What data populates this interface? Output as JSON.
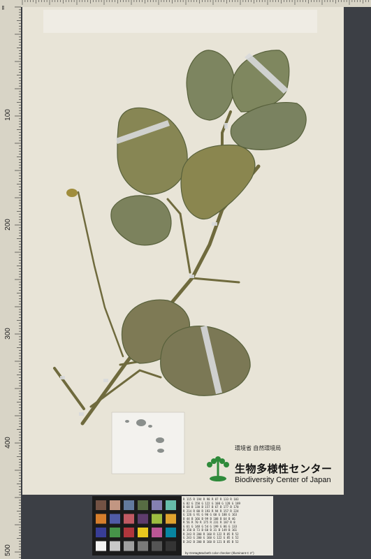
{
  "ruler": {
    "unit_label": "mm",
    "major_labels": [
      "100",
      "200",
      "300",
      "400",
      "500"
    ]
  },
  "label": {
    "agency": "環境省 自然環境局",
    "center_name_ja": "生物多様性センター",
    "center_name_en": "Biodiversity Center of Japan",
    "logo_color": "#2e8a3a"
  },
  "color_checker": {
    "caption": "by GretagMacbeth color checker (Illuminant C 2°)",
    "patch_colors": [
      "#735244",
      "#c29682",
      "#627a9d",
      "#576c43",
      "#8580b1",
      "#67bdaa",
      "#d67e2c",
      "#505ba6",
      "#c15a63",
      "#5e3c6c",
      "#9dbc40",
      "#e0a32e",
      "#383d96",
      "#469449",
      "#af363c",
      "#e7c71f",
      "#bb5695",
      "#0885a1",
      "#f3f3f2",
      "#c8c8c8",
      "#a0a0a0",
      "#7a7a79",
      "#555555",
      "#343434"
    ],
    "value_rows": [
      "R 115  R 194  R 98   R 87   R 133  R 103",
      "G 82   G 150  G 122  G 108  G 128  G 189",
      "B 68   B 130  B 157  B 67   B 177  B 170",
      "R 214  R 80   R 193  R 94   R 157  R 224",
      "G 126  G 91   G 90   G 60   G 188  G 163",
      "B 44   B 166  B 99   B 108  B 64   B 46",
      "R 56   R 70   R 175  R 231  R 187  R 8",
      "G 61   G 148  G 54   G 199  G 86   G 133",
      "B 150  B 73   B 60   B 31   B 149  B 161",
      "R 243  R 200  R 160  R 122  R 85   R 52",
      "G 243  G 200  G 160  G 122  G 85   G 52",
      "B 242  B 200  B 160  B 121  B 85   B 52"
    ]
  }
}
